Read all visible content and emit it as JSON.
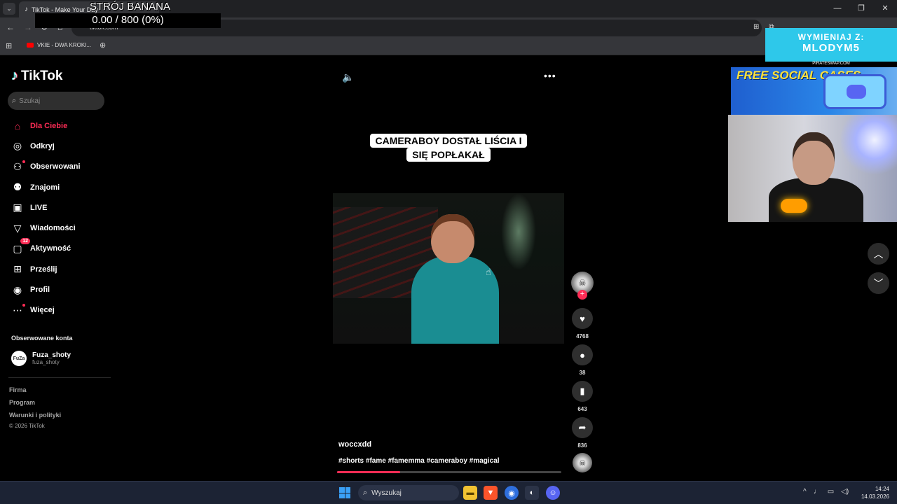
{
  "browser": {
    "tab_title": "TikTok - Make Your Day",
    "url": "tiktok.com",
    "bookmark": "VKIE - DWA KROKI..."
  },
  "overlay": {
    "banana_title": "STRÓJ BANANA",
    "banana_counter": "0.00 / 800 (0%)",
    "promo_line1": "WYMIENIAJ Z:",
    "promo_line2": "MLODYM5",
    "promo_url": "PIRATESWAP.COM",
    "promo2_text": "FREE SOCIAL CASES"
  },
  "sidebar": {
    "logo": "TikTok",
    "search_placeholder": "Szukaj",
    "items": [
      {
        "label": "Dla Ciebie",
        "icon": "home-icon"
      },
      {
        "label": "Odkryj",
        "icon": "compass-icon"
      },
      {
        "label": "Obserwowani",
        "icon": "following-icon"
      },
      {
        "label": "Znajomi",
        "icon": "friends-icon"
      },
      {
        "label": "LIVE",
        "icon": "live-icon"
      },
      {
        "label": "Wiadomości",
        "icon": "messages-icon"
      },
      {
        "label": "Aktywność",
        "icon": "activity-icon",
        "badge": "12"
      },
      {
        "label": "Prześlij",
        "icon": "upload-icon"
      },
      {
        "label": "Profil",
        "icon": "profile-icon"
      },
      {
        "label": "Więcej",
        "icon": "more-icon"
      }
    ],
    "followed_heading": "Obserwowane konta",
    "followed_account": {
      "name": "Fuza_shoty",
      "handle": "fuza_shoty",
      "avatar_text": "FuZa"
    },
    "footer": [
      "Firma",
      "Program",
      "Warunki i polityki"
    ],
    "copyright": "© 2026 TikTok"
  },
  "video": {
    "caption_line1": "CAMERABOY DOSTAŁ LIŚCIA I",
    "caption_line2": "SIĘ POPŁAKAŁ",
    "author": "woccxdd",
    "hashtags": "#shorts #fame #famemma #cameraboy #magical",
    "progress": 0.28
  },
  "actions": {
    "likes": "4768",
    "comments": "38",
    "saves": "643",
    "shares": "836"
  },
  "taskbar": {
    "search": "Wyszukaj",
    "time": "14:24",
    "date": "14.03.2026"
  },
  "colors": {
    "accent": "#fe2c55",
    "background": "#000000",
    "taskbar": "#1c2334"
  }
}
